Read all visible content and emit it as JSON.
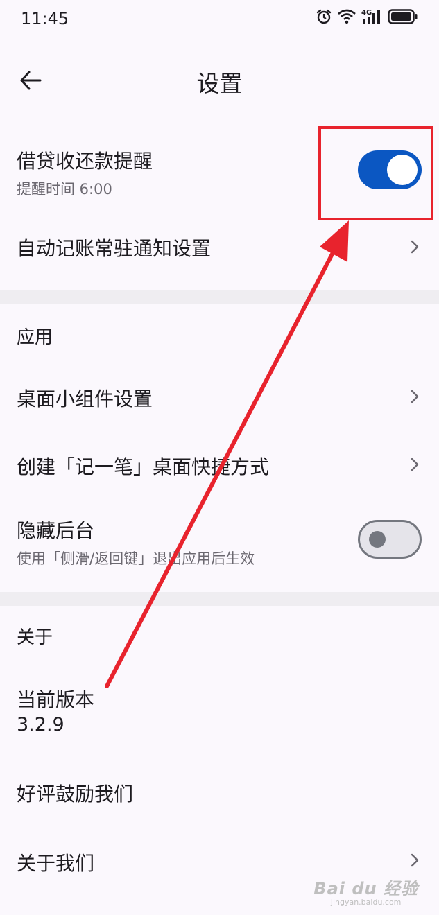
{
  "status_bar": {
    "time": "11:45",
    "icons": [
      "alarm-icon",
      "wifi-icon",
      "signal-4g-icon",
      "battery-icon"
    ],
    "network_label": "4G"
  },
  "app_bar": {
    "title": "设置",
    "back_icon": "arrow-left-icon"
  },
  "items": {
    "loan_reminder": {
      "title": "借贷收还款提醒",
      "subtitle": "提醒时间 6:00",
      "toggle": true
    },
    "auto_notify": {
      "title": "自动记账常驻通知设置"
    },
    "section_app": "应用",
    "widget": {
      "title": "桌面小组件设置"
    },
    "shortcut": {
      "title": "创建「记一笔」桌面快捷方式"
    },
    "hide_bg": {
      "title": "隐藏后台",
      "subtitle": "使用「侧滑/返回键」退出应用后生效",
      "toggle": false
    },
    "section_about": "关于",
    "version": {
      "title": "当前版本",
      "value": "3.2.9"
    },
    "rate": {
      "title": "好评鼓励我们"
    },
    "about_us": {
      "title": "关于我们"
    }
  },
  "annotation": {
    "color": "#e8232d"
  },
  "watermark": {
    "main": "Bai du 经验",
    "sub": "jingyan.baidu.com"
  },
  "colors": {
    "accent": "#0b57c2",
    "background": "#fbf8fd",
    "divider": "#efedf1"
  }
}
